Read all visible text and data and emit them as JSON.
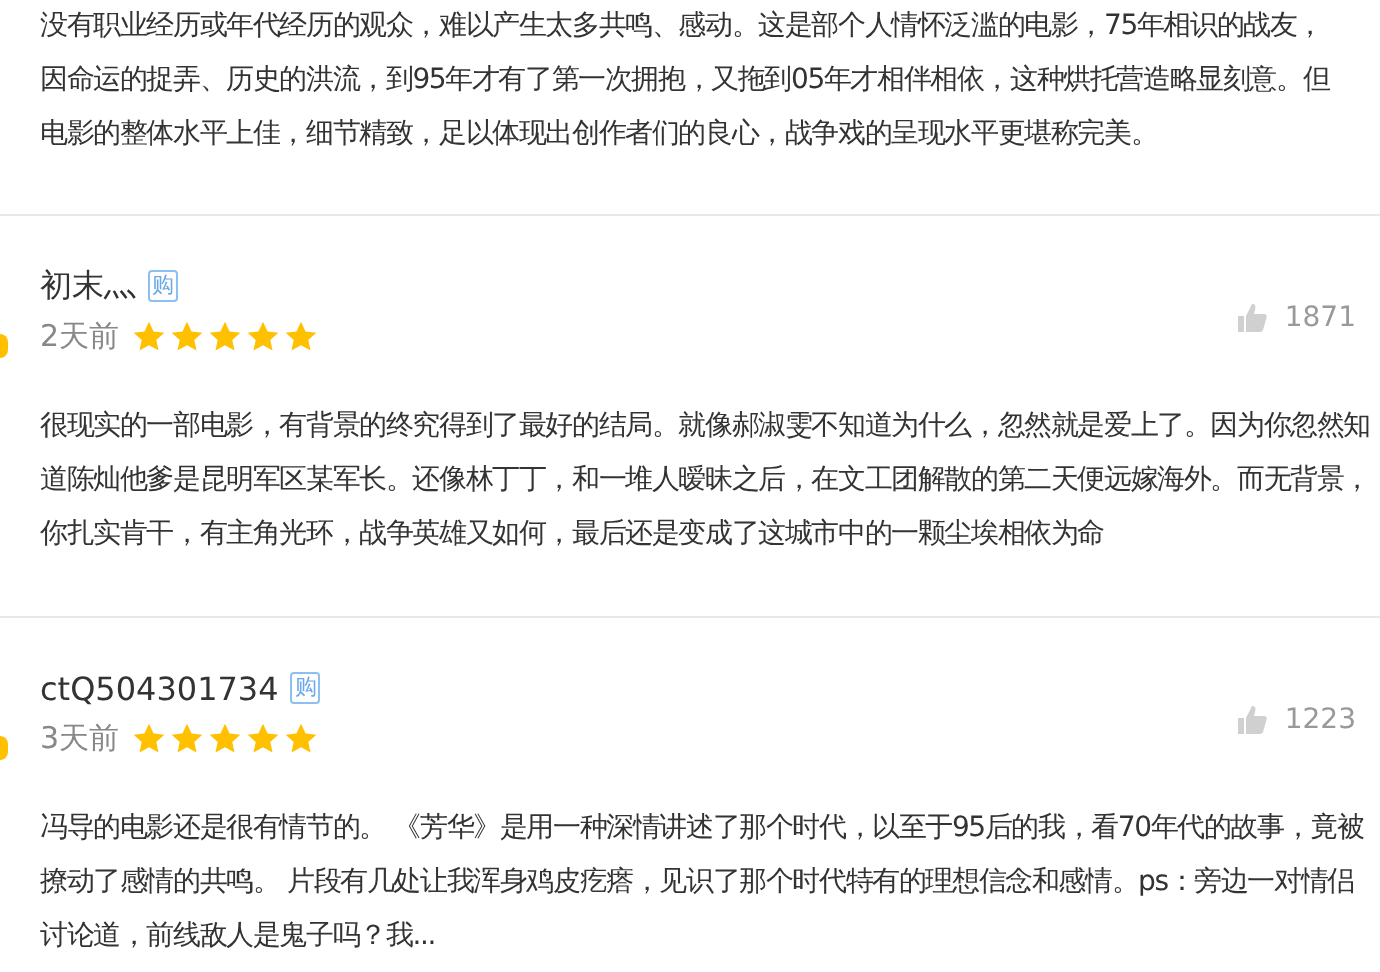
{
  "intro_text": "没有职业经历或年代经历的观众，难以产生太多共鸣、感动。这是部个人情怀泛滥的电影，75年相识的战友，因命运的捉弄、历史的洪流，到95年才有了第一次拥抱，又拖到05年才相伴相依，这种烘托营造略显刻意。但电影的整体水平上佳，细节精致，足以体现出创作者们的良心，战争戏的呈现水平更堪称完美。",
  "reviews": [
    {
      "user": "初末灬",
      "badge": "购",
      "time": "2天前",
      "stars": 5,
      "likes": "1871",
      "text": "很现实的一部电影，有背景的终究得到了最好的结局。就像郝淑雯不知道为什么，忽然就是爱上了。因为你忽然知道陈灿他爹是昆明军区某军长。还像林丁丁，和一堆人暧昧之后，在文工团解散的第二天便远嫁海外。而无背景，你扎实肯干，有主角光环，战争英雄又如何，最后还是变成了这城市中的一颗尘埃相依为命"
    },
    {
      "user": "ctQ504301734",
      "badge": "购",
      "time": "3天前",
      "stars": 5,
      "likes": "1223",
      "text": "冯导的电影还是很有情节的。 《芳华》是用一种深情讲述了那个时代，以至于95后的我，看70年代的故事，竟被撩动了感情的共鸣。 片段有几处让我浑身鸡皮疙瘩，见识了那个时代特有的理想信念和感情。ps：旁边一对情侣讨论道，前线敌人是鬼子吗？我..."
    }
  ]
}
